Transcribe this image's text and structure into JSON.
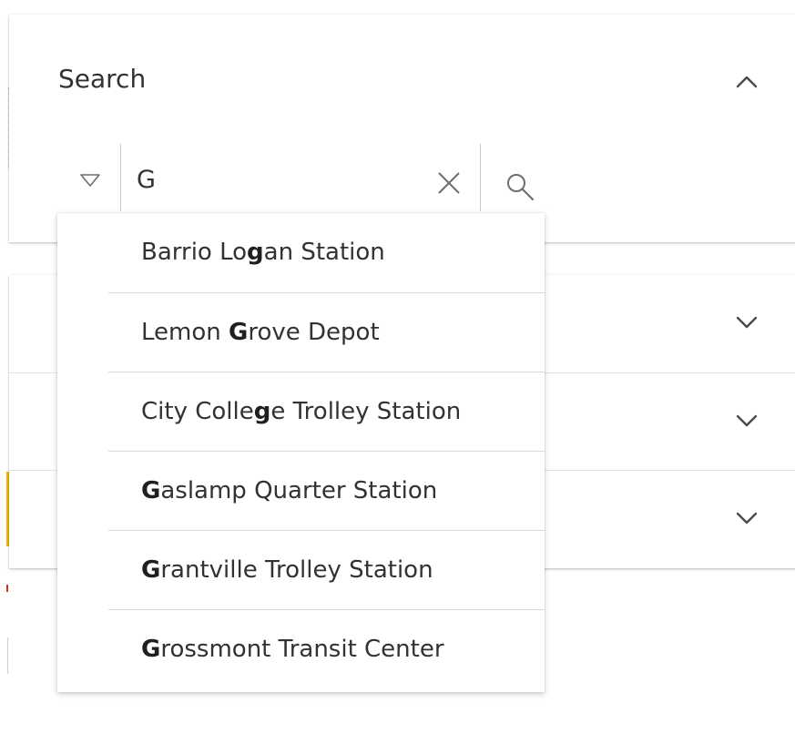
{
  "search": {
    "title": "Search",
    "value": "G",
    "type_filter_icon": "triangle-down-icon",
    "clear_icon": "close-icon",
    "search_icon": "search-icon",
    "collapse_icon": "chevron-up-icon"
  },
  "suggestions": [
    {
      "before": "Barrio Lo",
      "match": "g",
      "after": "an Station"
    },
    {
      "before": "Lemon ",
      "match": "G",
      "after": "rove Depot"
    },
    {
      "before": "City Colle",
      "match": "g",
      "after": "e Trolley Station"
    },
    {
      "before": "",
      "match": "G",
      "after": "aslamp Quarter Station"
    },
    {
      "before": "",
      "match": "G",
      "after": "rantville Trolley Station"
    },
    {
      "before": "",
      "match": "G",
      "after": "rossmont Transit Center"
    }
  ],
  "layers": {
    "expand_icon": "chevron-down-icon",
    "count": 3
  },
  "colors": {
    "text": "#323232",
    "divider": "#d9d9d9",
    "accent": "#f2b705",
    "icon": "#6e6e6e"
  }
}
